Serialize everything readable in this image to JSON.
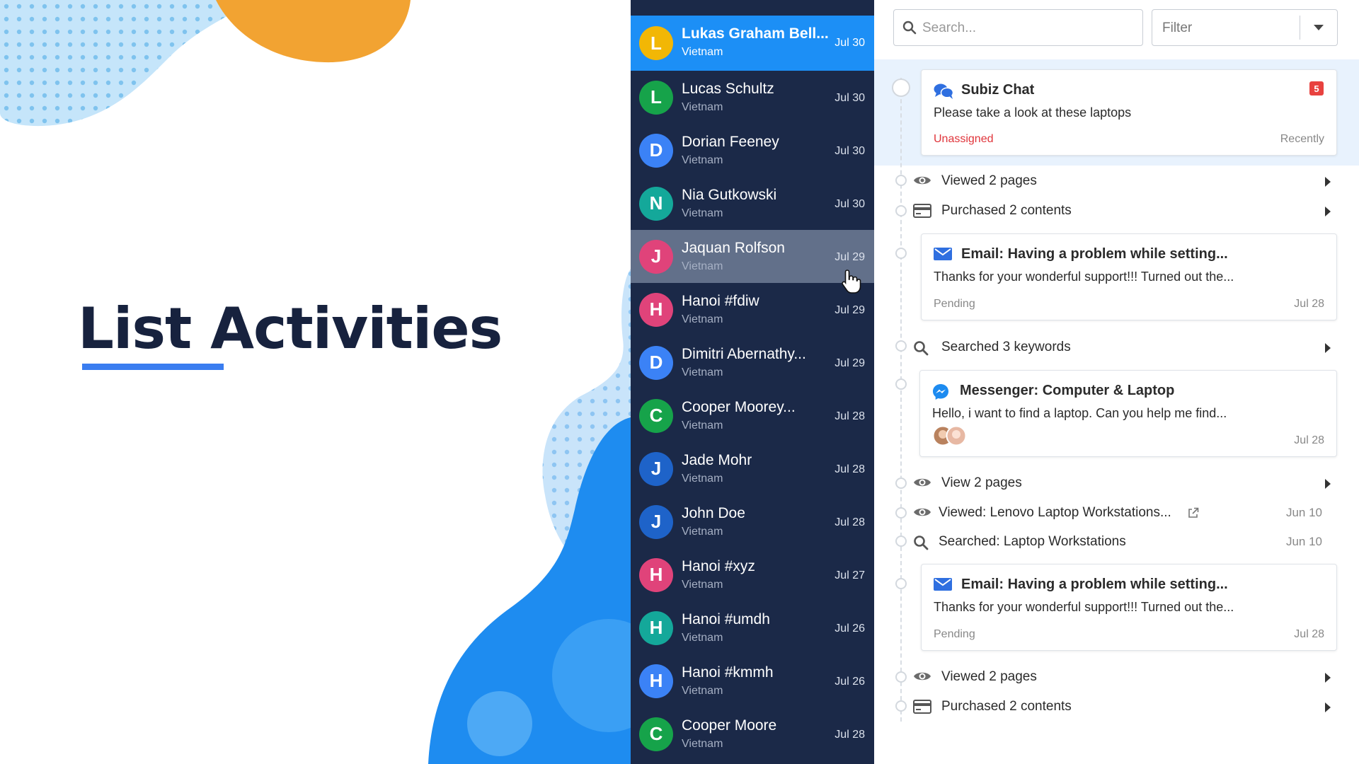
{
  "hero": {
    "title": "List Activities"
  },
  "colors": {
    "accent": "#3a7df0",
    "sidebar": "#1b2948",
    "active": "#1c8ff6",
    "unassigned": "#e0343a"
  },
  "contacts": [
    {
      "initial": "L",
      "name": "Lukas Graham Bell...",
      "country": "Vietnam",
      "date": "Jul 30",
      "color": "#f2b705"
    },
    {
      "initial": "L",
      "name": "Lucas Schultz",
      "country": "Vietnam",
      "date": "Jul 30",
      "color": "#16a34a"
    },
    {
      "initial": "D",
      "name": "Dorian Feeney",
      "country": "Vietnam",
      "date": "Jul 30",
      "color": "#3b82f6"
    },
    {
      "initial": "N",
      "name": "Nia Gutkowski",
      "country": "Vietnam",
      "date": "Jul 30",
      "color": "#14a89a"
    },
    {
      "initial": "J",
      "name": "Jaquan Rolfson",
      "country": "Vietnam",
      "date": "Jul 29",
      "color": "#e0437a"
    },
    {
      "initial": "H",
      "name": "Hanoi #fdiw",
      "country": "Vietnam",
      "date": "Jul 29",
      "color": "#e0437a"
    },
    {
      "initial": "D",
      "name": "Dimitri Abernathy...",
      "country": "Vietnam",
      "date": "Jul 29",
      "color": "#3b82f6"
    },
    {
      "initial": "C",
      "name": "Cooper Moorey...",
      "country": "Vietnam",
      "date": "Jul 28",
      "color": "#16a34a"
    },
    {
      "initial": "J",
      "name": "Jade Mohr",
      "country": "Vietnam",
      "date": "Jul 28",
      "color": "#1e63c9"
    },
    {
      "initial": "J",
      "name": "John Doe",
      "country": "Vietnam",
      "date": "Jul 28",
      "color": "#1e63c9"
    },
    {
      "initial": "H",
      "name": "Hanoi #xyz",
      "country": "Vietnam",
      "date": "Jul 27",
      "color": "#e0437a"
    },
    {
      "initial": "H",
      "name": "Hanoi #umdh",
      "country": "Vietnam",
      "date": "Jul 26",
      "color": "#14a89a"
    },
    {
      "initial": "H",
      "name": "Hanoi #kmmh",
      "country": "Vietnam",
      "date": "Jul 26",
      "color": "#3b82f6"
    },
    {
      "initial": "C",
      "name": "Cooper Moore",
      "country": "Vietnam",
      "date": "Jul 28",
      "color": "#16a34a"
    }
  ],
  "search": {
    "placeholder": "Search..."
  },
  "filter": {
    "label": "Filter"
  },
  "cards": {
    "chat": {
      "title": "Subiz Chat",
      "text": "Please take a look at these laptops",
      "status": "Unassigned",
      "date": "Recently",
      "badge": "5"
    },
    "email1": {
      "title": "Email: Having a problem while setting...",
      "text": "Thanks for your wonderful support!!! Turned out the...",
      "status": "Pending",
      "date": "Jul 28"
    },
    "messenger": {
      "title": "Messenger: Computer & Laptop",
      "text": "Hello, i want to find a laptop. Can you help me find...",
      "date": "Jul 28"
    },
    "email2": {
      "title": "Email: Having a problem while setting...",
      "text": "Thanks for your wonderful support!!! Turned out the...",
      "status": "Pending",
      "date": "Jul 28"
    }
  },
  "rows": {
    "viewed1": "Viewed 2 pages",
    "purchased1": "Purchased 2 contents",
    "searched": "Searched 3 keywords",
    "view2": "View 2 pages",
    "viewed_lenovo": {
      "text": "Viewed: Lenovo Laptop Workstations...",
      "date": "Jun 10"
    },
    "searched_laptop": {
      "text": "Searched: Laptop Workstations",
      "date": "Jun 10"
    },
    "viewed3": "Viewed 2 pages",
    "purchased2": "Purchased 2 contents"
  }
}
